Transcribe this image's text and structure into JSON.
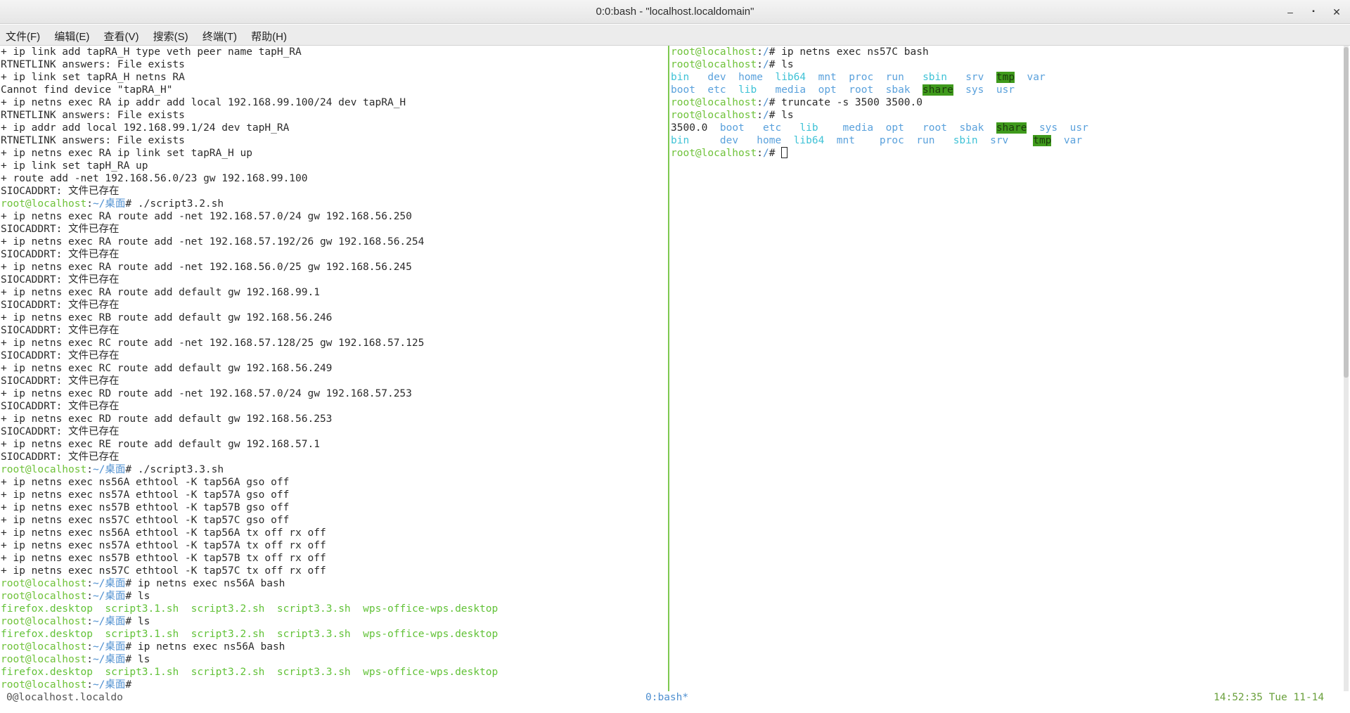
{
  "window": {
    "title": "0:0:bash - \"localhost.localdomain\"",
    "controls": {
      "minimize": "–",
      "maximize": "▪",
      "close": "✕"
    }
  },
  "menu": [
    "文件(F)",
    "编辑(E)",
    "查看(V)",
    "搜索(S)",
    "终端(T)",
    "帮助(H)"
  ],
  "left_pane": [
    {
      "t": "plain",
      "text": "+ ip link add tapRA_H type veth peer name tapH_RA"
    },
    {
      "t": "plain",
      "text": "RTNETLINK answers: File exists"
    },
    {
      "t": "plain",
      "text": "+ ip link set tapRA_H netns RA"
    },
    {
      "t": "plain",
      "text": "Cannot find device \"tapRA_H\""
    },
    {
      "t": "plain",
      "text": "+ ip netns exec RA ip addr add local 192.168.99.100/24 dev tapRA_H"
    },
    {
      "t": "plain",
      "text": "RTNETLINK answers: File exists"
    },
    {
      "t": "plain",
      "text": "+ ip addr add local 192.168.99.1/24 dev tapH_RA"
    },
    {
      "t": "plain",
      "text": "RTNETLINK answers: File exists"
    },
    {
      "t": "plain",
      "text": "+ ip netns exec RA ip link set tapRA_H up"
    },
    {
      "t": "plain",
      "text": "+ ip link set tapH_RA up"
    },
    {
      "t": "plain",
      "text": "+ route add -net 192.168.56.0/23 gw 192.168.99.100"
    },
    {
      "t": "plain",
      "text": "SIOCADDRT: 文件已存在"
    },
    {
      "t": "prompt",
      "user": "root@localhost",
      "sep": ":",
      "path": "~/桌面",
      "end": "# ",
      "cmd": "./script3.2.sh"
    },
    {
      "t": "plain",
      "text": "+ ip netns exec RA route add -net 192.168.57.0/24 gw 192.168.56.250"
    },
    {
      "t": "plain",
      "text": "SIOCADDRT: 文件已存在"
    },
    {
      "t": "plain",
      "text": "+ ip netns exec RA route add -net 192.168.57.192/26 gw 192.168.56.254"
    },
    {
      "t": "plain",
      "text": "SIOCADDRT: 文件已存在"
    },
    {
      "t": "plain",
      "text": "+ ip netns exec RA route add -net 192.168.56.0/25 gw 192.168.56.245"
    },
    {
      "t": "plain",
      "text": "SIOCADDRT: 文件已存在"
    },
    {
      "t": "plain",
      "text": "+ ip netns exec RA route add default gw 192.168.99.1"
    },
    {
      "t": "plain",
      "text": "SIOCADDRT: 文件已存在"
    },
    {
      "t": "plain",
      "text": "+ ip netns exec RB route add default gw 192.168.56.246"
    },
    {
      "t": "plain",
      "text": "SIOCADDRT: 文件已存在"
    },
    {
      "t": "plain",
      "text": "+ ip netns exec RC route add -net 192.168.57.128/25 gw 192.168.57.125"
    },
    {
      "t": "plain",
      "text": "SIOCADDRT: 文件已存在"
    },
    {
      "t": "plain",
      "text": "+ ip netns exec RC route add default gw 192.168.56.249"
    },
    {
      "t": "plain",
      "text": "SIOCADDRT: 文件已存在"
    },
    {
      "t": "plain",
      "text": "+ ip netns exec RD route add -net 192.168.57.0/24 gw 192.168.57.253"
    },
    {
      "t": "plain",
      "text": "SIOCADDRT: 文件已存在"
    },
    {
      "t": "plain",
      "text": "+ ip netns exec RD route add default gw 192.168.56.253"
    },
    {
      "t": "plain",
      "text": "SIOCADDRT: 文件已存在"
    },
    {
      "t": "plain",
      "text": "+ ip netns exec RE route add default gw 192.168.57.1"
    },
    {
      "t": "plain",
      "text": "SIOCADDRT: 文件已存在"
    },
    {
      "t": "prompt",
      "user": "root@localhost",
      "sep": ":",
      "path": "~/桌面",
      "end": "# ",
      "cmd": "./script3.3.sh"
    },
    {
      "t": "plain",
      "text": "+ ip netns exec ns56A ethtool -K tap56A gso off"
    },
    {
      "t": "plain",
      "text": "+ ip netns exec ns57A ethtool -K tap57A gso off"
    },
    {
      "t": "plain",
      "text": "+ ip netns exec ns57B ethtool -K tap57B gso off"
    },
    {
      "t": "plain",
      "text": "+ ip netns exec ns57C ethtool -K tap57C gso off"
    },
    {
      "t": "plain",
      "text": "+ ip netns exec ns56A ethtool -K tap56A tx off rx off"
    },
    {
      "t": "plain",
      "text": "+ ip netns exec ns57A ethtool -K tap57A tx off rx off"
    },
    {
      "t": "plain",
      "text": "+ ip netns exec ns57B ethtool -K tap57B tx off rx off"
    },
    {
      "t": "plain",
      "text": "+ ip netns exec ns57C ethtool -K tap57C tx off rx off"
    },
    {
      "t": "prompt",
      "user": "root@localhost",
      "sep": ":",
      "path": "~/桌面",
      "end": "# ",
      "cmd": "ip netns exec ns56A bash"
    },
    {
      "t": "prompt",
      "user": "root@localhost",
      "sep": ":",
      "path": "~/桌面",
      "end": "# ",
      "cmd": "ls"
    },
    {
      "t": "files",
      "items": [
        {
          "text": "firefox.desktop",
          "c": "exe"
        },
        {
          "text": "  "
        },
        {
          "text": "script3.1.sh",
          "c": "exe"
        },
        {
          "text": "  "
        },
        {
          "text": "script3.2.sh",
          "c": "exe"
        },
        {
          "text": "  "
        },
        {
          "text": "script3.3.sh",
          "c": "exe"
        },
        {
          "text": "  "
        },
        {
          "text": "wps-office-wps.desktop",
          "c": "exe"
        }
      ]
    },
    {
      "t": "prompt",
      "user": "root@localhost",
      "sep": ":",
      "path": "~/桌面",
      "end": "# ",
      "cmd": "ls"
    },
    {
      "t": "files",
      "items": [
        {
          "text": "firefox.desktop",
          "c": "exe"
        },
        {
          "text": "  "
        },
        {
          "text": "script3.1.sh",
          "c": "exe"
        },
        {
          "text": "  "
        },
        {
          "text": "script3.2.sh",
          "c": "exe"
        },
        {
          "text": "  "
        },
        {
          "text": "script3.3.sh",
          "c": "exe"
        },
        {
          "text": "  "
        },
        {
          "text": "wps-office-wps.desktop",
          "c": "exe"
        }
      ]
    },
    {
      "t": "prompt",
      "user": "root@localhost",
      "sep": ":",
      "path": "~/桌面",
      "end": "# ",
      "cmd": "ip netns exec ns56A bash"
    },
    {
      "t": "prompt",
      "user": "root@localhost",
      "sep": ":",
      "path": "~/桌面",
      "end": "# ",
      "cmd": "ls"
    },
    {
      "t": "files",
      "items": [
        {
          "text": "firefox.desktop",
          "c": "exe"
        },
        {
          "text": "  "
        },
        {
          "text": "script3.1.sh",
          "c": "exe"
        },
        {
          "text": "  "
        },
        {
          "text": "script3.2.sh",
          "c": "exe"
        },
        {
          "text": "  "
        },
        {
          "text": "script3.3.sh",
          "c": "exe"
        },
        {
          "text": "  "
        },
        {
          "text": "wps-office-wps.desktop",
          "c": "exe"
        }
      ]
    },
    {
      "t": "prompt",
      "user": "root@localhost",
      "sep": ":",
      "path": "~/桌面",
      "end": "# ",
      "cmd": ""
    }
  ],
  "right_pane": [
    {
      "t": "prompt",
      "user": "root@localhost",
      "sep": ":",
      "path": "/",
      "end": "# ",
      "cmd": "ip netns exec ns57C bash"
    },
    {
      "t": "prompt",
      "user": "root@localhost",
      "sep": ":",
      "path": "/",
      "end": "# ",
      "cmd": "ls"
    },
    {
      "t": "files",
      "items": [
        {
          "text": "bin",
          "c": "cy"
        },
        {
          "text": "   "
        },
        {
          "text": "dev",
          "c": "dir"
        },
        {
          "text": "  "
        },
        {
          "text": "home",
          "c": "dir"
        },
        {
          "text": "  "
        },
        {
          "text": "lib64",
          "c": "cy"
        },
        {
          "text": "  "
        },
        {
          "text": "mnt",
          "c": "dir"
        },
        {
          "text": "  "
        },
        {
          "text": "proc",
          "c": "dir"
        },
        {
          "text": "  "
        },
        {
          "text": "run",
          "c": "dir"
        },
        {
          "text": "   "
        },
        {
          "text": "sbin",
          "c": "cy"
        },
        {
          "text": "   "
        },
        {
          "text": "srv",
          "c": "dir"
        },
        {
          "text": "  "
        },
        {
          "text": "tmp",
          "c": "hl"
        },
        {
          "text": "  "
        },
        {
          "text": "var",
          "c": "dir"
        }
      ]
    },
    {
      "t": "files",
      "items": [
        {
          "text": "boot",
          "c": "dir"
        },
        {
          "text": "  "
        },
        {
          "text": "etc",
          "c": "dir"
        },
        {
          "text": "  "
        },
        {
          "text": "lib",
          "c": "cy"
        },
        {
          "text": "   "
        },
        {
          "text": "media",
          "c": "dir"
        },
        {
          "text": "  "
        },
        {
          "text": "opt",
          "c": "dir"
        },
        {
          "text": "  "
        },
        {
          "text": "root",
          "c": "dir"
        },
        {
          "text": "  "
        },
        {
          "text": "sbak",
          "c": "dir"
        },
        {
          "text": "  "
        },
        {
          "text": "share",
          "c": "hl"
        },
        {
          "text": "  "
        },
        {
          "text": "sys",
          "c": "dir"
        },
        {
          "text": "  "
        },
        {
          "text": "usr",
          "c": "dir"
        }
      ]
    },
    {
      "t": "prompt",
      "user": "root@localhost",
      "sep": ":",
      "path": "/",
      "end": "# ",
      "cmd": "truncate -s 3500 3500.0"
    },
    {
      "t": "prompt",
      "user": "root@localhost",
      "sep": ":",
      "path": "/",
      "end": "# ",
      "cmd": "ls"
    },
    {
      "t": "files",
      "items": [
        {
          "text": "3500.0",
          "c": ""
        },
        {
          "text": "  "
        },
        {
          "text": "boot",
          "c": "dir"
        },
        {
          "text": "   "
        },
        {
          "text": "etc",
          "c": "dir"
        },
        {
          "text": "   "
        },
        {
          "text": "lib",
          "c": "cy"
        },
        {
          "text": "    "
        },
        {
          "text": "media",
          "c": "dir"
        },
        {
          "text": "  "
        },
        {
          "text": "opt",
          "c": "dir"
        },
        {
          "text": "   "
        },
        {
          "text": "root",
          "c": "dir"
        },
        {
          "text": "  "
        },
        {
          "text": "sbak",
          "c": "dir"
        },
        {
          "text": "  "
        },
        {
          "text": "share",
          "c": "hl"
        },
        {
          "text": "  "
        },
        {
          "text": "sys",
          "c": "dir"
        },
        {
          "text": "  "
        },
        {
          "text": "usr",
          "c": "dir"
        }
      ]
    },
    {
      "t": "files",
      "items": [
        {
          "text": "bin",
          "c": "cy"
        },
        {
          "text": "     "
        },
        {
          "text": "dev",
          "c": "dir"
        },
        {
          "text": "   "
        },
        {
          "text": "home",
          "c": "dir"
        },
        {
          "text": "  "
        },
        {
          "text": "lib64",
          "c": "cy"
        },
        {
          "text": "  "
        },
        {
          "text": "mnt",
          "c": "dir"
        },
        {
          "text": "    "
        },
        {
          "text": "proc",
          "c": "dir"
        },
        {
          "text": "  "
        },
        {
          "text": "run",
          "c": "dir"
        },
        {
          "text": "   "
        },
        {
          "text": "sbin",
          "c": "cy"
        },
        {
          "text": "  "
        },
        {
          "text": "srv",
          "c": "dir"
        },
        {
          "text": "    "
        },
        {
          "text": "tmp",
          "c": "hl"
        },
        {
          "text": "  "
        },
        {
          "text": "var",
          "c": "dir"
        }
      ]
    },
    {
      "t": "prompt",
      "user": "root@localhost",
      "sep": ":",
      "path": "/",
      "end": "# ",
      "cmd": "",
      "cursor": true
    }
  ],
  "status": {
    "left": "0@localhost.localdo",
    "middle": "0:bash*",
    "right": "14:52:35 Tue 11-14"
  }
}
